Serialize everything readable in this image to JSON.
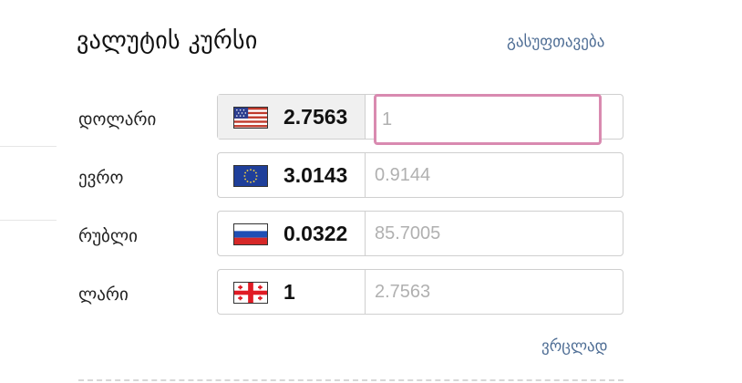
{
  "widget": {
    "title": "ვალუტის კურსი",
    "reset_label": "გასუფთავება",
    "details_label": "ვრცლად"
  },
  "currencies": [
    {
      "label": "დოლარი",
      "flag": "us-flag-icon",
      "rate": "2.7563",
      "input_value": "",
      "input_placeholder": "1"
    },
    {
      "label": "ევრო",
      "flag": "eu-flag-icon",
      "rate": "3.0143",
      "input_value": "",
      "input_placeholder": "0.9144"
    },
    {
      "label": "რუბლი",
      "flag": "ru-flag-icon",
      "rate": "0.0322",
      "input_value": "",
      "input_placeholder": "85.7005"
    },
    {
      "label": "ლარი",
      "flag": "ge-flag-icon",
      "rate": "1",
      "input_value": "",
      "input_placeholder": "2.7563"
    }
  ],
  "colors": {
    "link": "#4f6e95",
    "focus_border": "#d98ab0",
    "box_border": "#cfcfcf",
    "active_cell": "#f0f0f0"
  }
}
